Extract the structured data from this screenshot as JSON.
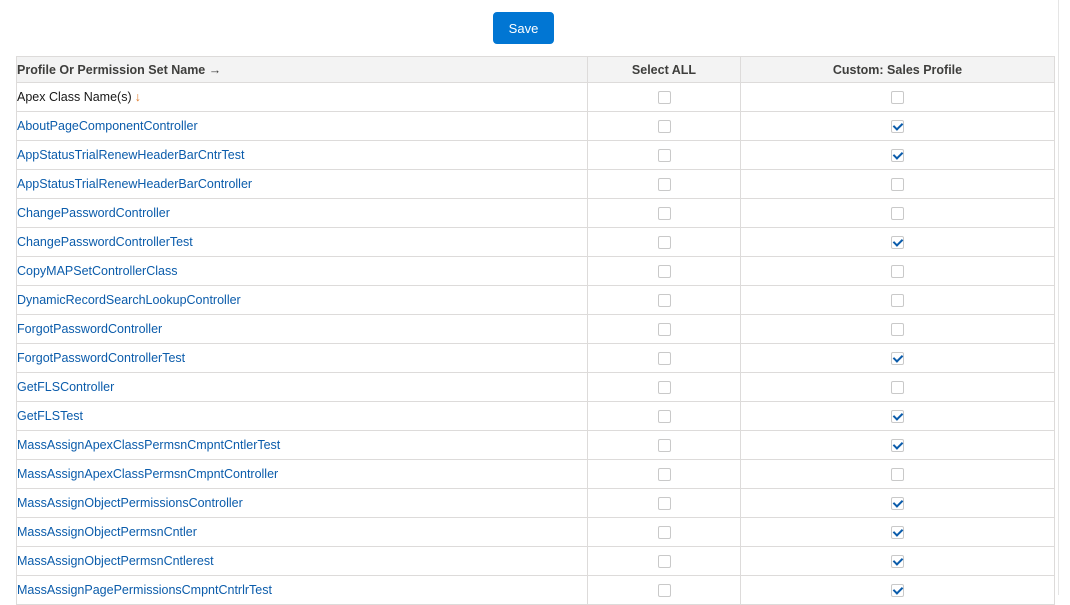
{
  "toolbar": {
    "save_label": "Save"
  },
  "table": {
    "headers": {
      "name": "Profile Or Permission Set Name →",
      "select_all": "Select ALL",
      "profile": "Custom: Sales Profile"
    },
    "subheader": {
      "label": "Apex Class Name(s)",
      "sort_arrow": "↓"
    },
    "subheader_select_all_checked": false,
    "subheader_profile_checked": false,
    "rows": [
      {
        "name": "AboutPageComponentController",
        "select_all": false,
        "profile": true
      },
      {
        "name": "AppStatusTrialRenewHeaderBarCntrTest",
        "select_all": false,
        "profile": true
      },
      {
        "name": "AppStatusTrialRenewHeaderBarController",
        "select_all": false,
        "profile": false
      },
      {
        "name": "ChangePasswordController",
        "select_all": false,
        "profile": false
      },
      {
        "name": "ChangePasswordControllerTest",
        "select_all": false,
        "profile": true
      },
      {
        "name": "CopyMAPSetControllerClass",
        "select_all": false,
        "profile": false
      },
      {
        "name": "DynamicRecordSearchLookupController",
        "select_all": false,
        "profile": false
      },
      {
        "name": "ForgotPasswordController",
        "select_all": false,
        "profile": false
      },
      {
        "name": "ForgotPasswordControllerTest",
        "select_all": false,
        "profile": true
      },
      {
        "name": "GetFLSController",
        "select_all": false,
        "profile": false
      },
      {
        "name": "GetFLSTest",
        "select_all": false,
        "profile": true
      },
      {
        "name": "MassAssignApexClassPermsnCmpntCntlerTest",
        "select_all": false,
        "profile": true
      },
      {
        "name": "MassAssignApexClassPermsnCmpntController",
        "select_all": false,
        "profile": false
      },
      {
        "name": "MassAssignObjectPermissionsController",
        "select_all": false,
        "profile": true
      },
      {
        "name": "MassAssignObjectPermsnCntler",
        "select_all": false,
        "profile": true
      },
      {
        "name": "MassAssignObjectPermsnCntlerest",
        "select_all": false,
        "profile": true
      },
      {
        "name": "MassAssignPagePermissionsCmpntCntrlrTest",
        "select_all": false,
        "profile": true
      }
    ]
  }
}
